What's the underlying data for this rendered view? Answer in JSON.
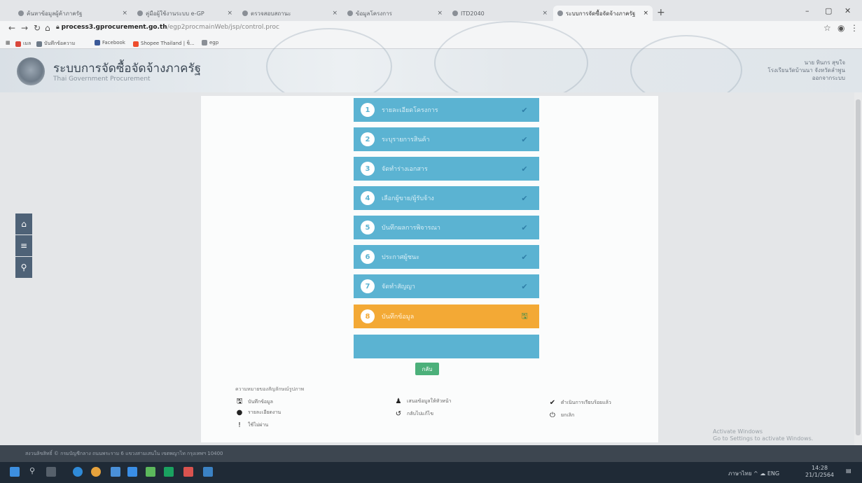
{
  "browser": {
    "tabs": [
      {
        "title": "ค้นหาข้อมูลผู้ค้าภาครัฐ"
      },
      {
        "title": "คู่มือผู้ใช้งานระบบ e-GP"
      },
      {
        "title": "ตรวจสอบสถานะ"
      },
      {
        "title": "ข้อมูลโครงการ"
      },
      {
        "title": "ITD2040"
      },
      {
        "title": "ระบบการจัดซื้อจัดจ้างภาครัฐ"
      }
    ],
    "new_tab": "+",
    "url_domain": "process3.gprocurement.go.th",
    "url_path": "/egp2procmainWeb/jsp/control.proc",
    "bookmarks": [
      {
        "label": "เมล",
        "color": "#d9473b"
      },
      {
        "label": "บันทึกข้อความ",
        "color": "#6d7a88"
      },
      {
        "label": "Facebook",
        "color": "#3b5998"
      },
      {
        "label": "Shopee Thailand | ช็...",
        "color": "#ee4d2d"
      },
      {
        "label": "egp",
        "color": "#8a8f96"
      }
    ]
  },
  "header": {
    "title": "ระบบการจัดซื้อจัดจ้างภาครัฐ",
    "subtitle": "Thai Government Procurement",
    "user_lines": [
      "นาย ทินกร สุขใจ",
      "โรงเรียนวัดบ้านนา จังหวัดลำพูน",
      "ออกจากระบบ"
    ]
  },
  "side_buttons": [
    {
      "name": "home-icon",
      "glyph": "⌂"
    },
    {
      "name": "menu-icon",
      "glyph": "≡"
    },
    {
      "name": "search-icon",
      "glyph": "⚲"
    }
  ],
  "steps": [
    {
      "num": "1",
      "label": "รายละเอียดโครงการ",
      "status": "✔"
    },
    {
      "num": "2",
      "label": "ระบุรายการสินค้า",
      "status": "✔"
    },
    {
      "num": "3",
      "label": "จัดทำร่างเอกสาร",
      "status": "✔"
    },
    {
      "num": "4",
      "label": "เลือกผู้ขาย/ผู้รับจ้าง",
      "status": "✔"
    },
    {
      "num": "5",
      "label": "บันทึกผลการพิจารณา",
      "status": "✔"
    },
    {
      "num": "6",
      "label": "ประกาศผู้ชนะ",
      "status": "✔"
    },
    {
      "num": "7",
      "label": "จัดทำสัญญา",
      "status": "✔"
    },
    {
      "num": "8",
      "label": "บันทึกข้อมูล",
      "status": "🖫"
    }
  ],
  "main_button": "กลับ",
  "legend": {
    "title": "ความหมายของสัญลักษณ์รูปภาพ",
    "items": [
      {
        "name": "save-icon",
        "glyph": "🖫",
        "label": "บันทึกข้อมูล"
      },
      {
        "name": "chat-icon",
        "glyph": "●",
        "label": "รายละเอียดงาน"
      },
      {
        "name": "alert-icon",
        "glyph": "!",
        "label": "ใช้ไม่ผ่าน"
      },
      {
        "name": "user-icon",
        "glyph": "♟",
        "label": "เสนอข้อมูลให้หัวหน้า"
      },
      {
        "name": "undo-icon",
        "glyph": "↺",
        "label": "กลับไปแก้ไข"
      },
      {
        "name": "check-icon",
        "glyph": "✔",
        "label": "ดำเนินการเรียบร้อยแล้ว"
      },
      {
        "name": "power-icon",
        "glyph": "⏻",
        "label": "ยกเลิก"
      }
    ]
  },
  "watermark": [
    "Activate Windows",
    "Go to Settings to activate Windows."
  ],
  "status_text": "สงวนลิขสิทธิ์ © กรมบัญชีกลาง ถนนพระราม 6 แขวงสามเสนใน เขตพญาไท กรุงเทพฯ 10400",
  "taskbar": {
    "apps": [
      "#2f8ad8",
      "#e6a23c",
      "#4a90d9",
      "#3a8ee6",
      "#5cb85c",
      "#1aa260",
      "#d9534f",
      "#3b82c4"
    ],
    "time": "14:28",
    "date": "21/1/2564",
    "tray": "ภาษาไทย ^ ☁ ENG"
  }
}
